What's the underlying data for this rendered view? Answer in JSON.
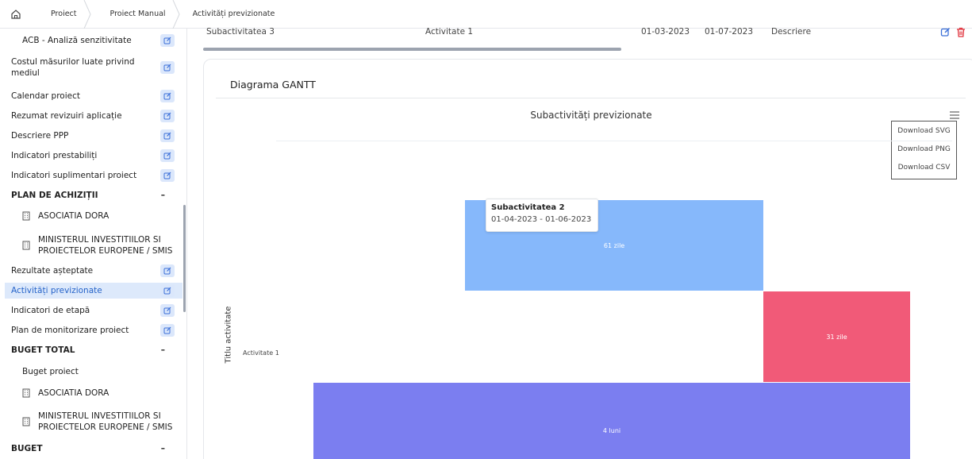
{
  "breadcrumb": {
    "items": [
      "Proiect",
      "Proiect Manual",
      "Activități previzionate"
    ]
  },
  "sidebar": {
    "items": [
      {
        "label": "ACB - Analiză senzitivitate",
        "kind": "sub-edit"
      },
      {
        "label": "Costul măsurilor luate privind mediul",
        "kind": "edit"
      },
      {
        "label": "Calendar proiect",
        "kind": "edit"
      },
      {
        "label": "Rezumat revizuiri aplicație",
        "kind": "edit"
      },
      {
        "label": "Descriere PPP",
        "kind": "edit"
      },
      {
        "label": "Indicatori prestabiliți",
        "kind": "edit"
      },
      {
        "label": "Indicatori suplimentari proiect",
        "kind": "edit"
      },
      {
        "label": "PLAN DE ACHIZIȚII",
        "kind": "header",
        "toggle": "–"
      },
      {
        "label": "ASOCIATIA DORA",
        "kind": "building"
      },
      {
        "label": "MINISTERUL INVESTITIILOR SI PROIECTELOR EUROPENE / SMIS",
        "kind": "building"
      },
      {
        "label": "Rezultate așteptate",
        "kind": "edit"
      },
      {
        "label": "Activități previzionate",
        "kind": "edit-active"
      },
      {
        "label": "Indicatori de etapă",
        "kind": "edit"
      },
      {
        "label": "Plan de monitorizare proiect",
        "kind": "edit"
      },
      {
        "label": "BUGET TOTAL",
        "kind": "header",
        "toggle": "–"
      },
      {
        "label": "Buget proiect",
        "kind": "sub"
      },
      {
        "label": "ASOCIATIA DORA",
        "kind": "building"
      },
      {
        "label": "MINISTERUL INVESTITIILOR SI PROIECTELOR EUROPENE / SMIS",
        "kind": "building"
      },
      {
        "label": "BUGET",
        "kind": "header",
        "toggle": "–"
      }
    ]
  },
  "table_row": {
    "subactivity": "Subactivitatea 3",
    "activity": "Activitate 1",
    "start": "01-03-2023",
    "end": "01-07-2023",
    "description": "Descriere"
  },
  "gantt": {
    "section_title": "Diagrama GANTT",
    "menu": [
      "Download SVG",
      "Download PNG",
      "Download CSV"
    ]
  },
  "chart_data": {
    "type": "bar",
    "title": "Subactivități previzionate",
    "ylabel": "Titlu activitate",
    "categories": [
      "Activitate 1"
    ],
    "series": [
      {
        "start": "2023-04-01",
        "end": "2023-06-01",
        "label": "61 zile",
        "color": "#86b8fb"
      },
      {
        "start": "2023-06-01",
        "end": "2023-07-01",
        "label": "31 zile",
        "color": "#f15a78"
      },
      {
        "start": "2023-03-01",
        "end": "2023-07-01",
        "label": "4 luni",
        "color": "#7b7ef0"
      }
    ],
    "tooltip": {
      "title": "Subactivitatea 2",
      "range": "01-04-2023 - 01-06-2023"
    },
    "colors": {
      "blue": "#86b8fb",
      "red": "#f15a78",
      "purple": "#7b7ef0"
    }
  }
}
